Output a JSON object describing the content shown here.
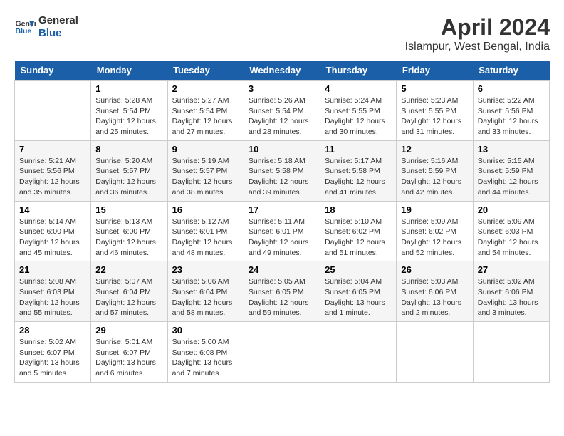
{
  "logo": {
    "line1": "General",
    "line2": "Blue"
  },
  "title": "April 2024",
  "subtitle": "Islampur, West Bengal, India",
  "days_of_week": [
    "Sunday",
    "Monday",
    "Tuesday",
    "Wednesday",
    "Thursday",
    "Friday",
    "Saturday"
  ],
  "weeks": [
    [
      {
        "day": "",
        "info": ""
      },
      {
        "day": "1",
        "info": "Sunrise: 5:28 AM\nSunset: 5:54 PM\nDaylight: 12 hours\nand 25 minutes."
      },
      {
        "day": "2",
        "info": "Sunrise: 5:27 AM\nSunset: 5:54 PM\nDaylight: 12 hours\nand 27 minutes."
      },
      {
        "day": "3",
        "info": "Sunrise: 5:26 AM\nSunset: 5:54 PM\nDaylight: 12 hours\nand 28 minutes."
      },
      {
        "day": "4",
        "info": "Sunrise: 5:24 AM\nSunset: 5:55 PM\nDaylight: 12 hours\nand 30 minutes."
      },
      {
        "day": "5",
        "info": "Sunrise: 5:23 AM\nSunset: 5:55 PM\nDaylight: 12 hours\nand 31 minutes."
      },
      {
        "day": "6",
        "info": "Sunrise: 5:22 AM\nSunset: 5:56 PM\nDaylight: 12 hours\nand 33 minutes."
      }
    ],
    [
      {
        "day": "7",
        "info": "Sunrise: 5:21 AM\nSunset: 5:56 PM\nDaylight: 12 hours\nand 35 minutes."
      },
      {
        "day": "8",
        "info": "Sunrise: 5:20 AM\nSunset: 5:57 PM\nDaylight: 12 hours\nand 36 minutes."
      },
      {
        "day": "9",
        "info": "Sunrise: 5:19 AM\nSunset: 5:57 PM\nDaylight: 12 hours\nand 38 minutes."
      },
      {
        "day": "10",
        "info": "Sunrise: 5:18 AM\nSunset: 5:58 PM\nDaylight: 12 hours\nand 39 minutes."
      },
      {
        "day": "11",
        "info": "Sunrise: 5:17 AM\nSunset: 5:58 PM\nDaylight: 12 hours\nand 41 minutes."
      },
      {
        "day": "12",
        "info": "Sunrise: 5:16 AM\nSunset: 5:59 PM\nDaylight: 12 hours\nand 42 minutes."
      },
      {
        "day": "13",
        "info": "Sunrise: 5:15 AM\nSunset: 5:59 PM\nDaylight: 12 hours\nand 44 minutes."
      }
    ],
    [
      {
        "day": "14",
        "info": "Sunrise: 5:14 AM\nSunset: 6:00 PM\nDaylight: 12 hours\nand 45 minutes."
      },
      {
        "day": "15",
        "info": "Sunrise: 5:13 AM\nSunset: 6:00 PM\nDaylight: 12 hours\nand 46 minutes."
      },
      {
        "day": "16",
        "info": "Sunrise: 5:12 AM\nSunset: 6:01 PM\nDaylight: 12 hours\nand 48 minutes."
      },
      {
        "day": "17",
        "info": "Sunrise: 5:11 AM\nSunset: 6:01 PM\nDaylight: 12 hours\nand 49 minutes."
      },
      {
        "day": "18",
        "info": "Sunrise: 5:10 AM\nSunset: 6:02 PM\nDaylight: 12 hours\nand 51 minutes."
      },
      {
        "day": "19",
        "info": "Sunrise: 5:09 AM\nSunset: 6:02 PM\nDaylight: 12 hours\nand 52 minutes."
      },
      {
        "day": "20",
        "info": "Sunrise: 5:09 AM\nSunset: 6:03 PM\nDaylight: 12 hours\nand 54 minutes."
      }
    ],
    [
      {
        "day": "21",
        "info": "Sunrise: 5:08 AM\nSunset: 6:03 PM\nDaylight: 12 hours\nand 55 minutes."
      },
      {
        "day": "22",
        "info": "Sunrise: 5:07 AM\nSunset: 6:04 PM\nDaylight: 12 hours\nand 57 minutes."
      },
      {
        "day": "23",
        "info": "Sunrise: 5:06 AM\nSunset: 6:04 PM\nDaylight: 12 hours\nand 58 minutes."
      },
      {
        "day": "24",
        "info": "Sunrise: 5:05 AM\nSunset: 6:05 PM\nDaylight: 12 hours\nand 59 minutes."
      },
      {
        "day": "25",
        "info": "Sunrise: 5:04 AM\nSunset: 6:05 PM\nDaylight: 13 hours\nand 1 minute."
      },
      {
        "day": "26",
        "info": "Sunrise: 5:03 AM\nSunset: 6:06 PM\nDaylight: 13 hours\nand 2 minutes."
      },
      {
        "day": "27",
        "info": "Sunrise: 5:02 AM\nSunset: 6:06 PM\nDaylight: 13 hours\nand 3 minutes."
      }
    ],
    [
      {
        "day": "28",
        "info": "Sunrise: 5:02 AM\nSunset: 6:07 PM\nDaylight: 13 hours\nand 5 minutes."
      },
      {
        "day": "29",
        "info": "Sunrise: 5:01 AM\nSunset: 6:07 PM\nDaylight: 13 hours\nand 6 minutes."
      },
      {
        "day": "30",
        "info": "Sunrise: 5:00 AM\nSunset: 6:08 PM\nDaylight: 13 hours\nand 7 minutes."
      },
      {
        "day": "",
        "info": ""
      },
      {
        "day": "",
        "info": ""
      },
      {
        "day": "",
        "info": ""
      },
      {
        "day": "",
        "info": ""
      }
    ]
  ]
}
